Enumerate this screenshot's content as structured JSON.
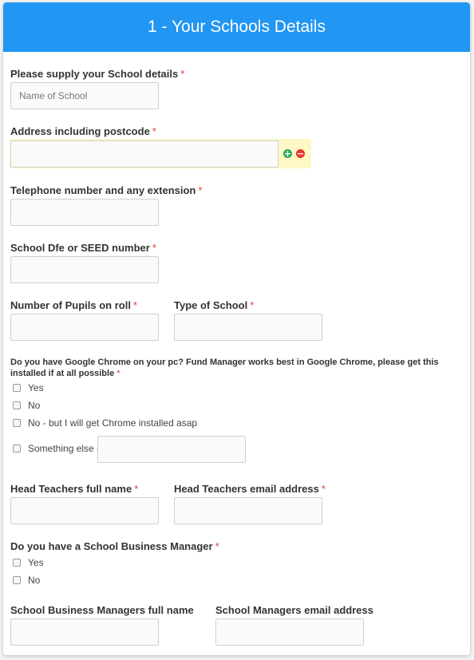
{
  "header": {
    "title": "1 - Your Schools Details"
  },
  "fields": {
    "school_name": {
      "label": "Please supply your School details",
      "placeholder": "Name of School",
      "required": "*"
    },
    "address": {
      "label": "Address including postcode",
      "required": "*"
    },
    "telephone": {
      "label": "Telephone number and any extension",
      "required": "*"
    },
    "dfe": {
      "label": "School Dfe or SEED number",
      "required": "*"
    },
    "pupils": {
      "label": "Number of Pupils on roll",
      "required": "*"
    },
    "school_type": {
      "label": "Type of School",
      "required": "*"
    },
    "head_name": {
      "label": "Head Teachers full name",
      "required": "*"
    },
    "head_email": {
      "label": "Head Teachers email address",
      "required": "*"
    },
    "sbm_name": {
      "label": "School Business Managers full name"
    },
    "sbm_email": {
      "label": "School Managers email address"
    }
  },
  "chrome_question": {
    "label": "Do you have Google Chrome on your pc? Fund Manager works best in Google Chrome, please get this installed if at all possible",
    "required": "*",
    "options": [
      "Yes",
      "No",
      "No - but I will get Chrome installed asap",
      "Something else -"
    ]
  },
  "sbm_question": {
    "label": "Do you have a School Business Manager",
    "required": "*",
    "options": [
      "Yes",
      "No"
    ]
  },
  "address_controls": {
    "add_icon": "plus-circle-icon",
    "remove_icon": "minus-circle-icon"
  },
  "colors": {
    "header": "#2196f3",
    "required": "#e53935",
    "add": "#2eaa5c",
    "remove": "#e53935",
    "highlight": "#fdf8c4"
  }
}
